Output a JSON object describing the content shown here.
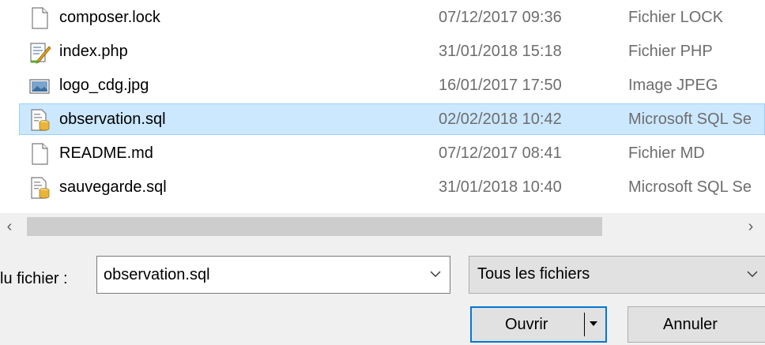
{
  "files": [
    {
      "name": "composer.lock",
      "date": "07/12/2017 09:36",
      "type": "Fichier LOCK",
      "icon": "blank-file-icon",
      "selected": false
    },
    {
      "name": "index.php",
      "date": "31/01/2018 15:18",
      "type": "Fichier PHP",
      "icon": "php-file-icon",
      "selected": false
    },
    {
      "name": "logo_cdg.jpg",
      "date": "16/01/2017 17:50",
      "type": "Image JPEG",
      "icon": "image-file-icon",
      "selected": false
    },
    {
      "name": "observation.sql",
      "date": "02/02/2018 10:42",
      "type": "Microsoft SQL Se",
      "icon": "sql-file-icon",
      "selected": true
    },
    {
      "name": "README.md",
      "date": "07/12/2017 08:41",
      "type": "Fichier MD",
      "icon": "blank-file-icon",
      "selected": false
    },
    {
      "name": "sauvegarde.sql",
      "date": "31/01/2018 10:40",
      "type": "Microsoft SQL Se",
      "icon": "sql-file-icon",
      "selected": false
    }
  ],
  "scrollbar": {
    "left_arrow": "‹",
    "right_arrow": "›"
  },
  "filename": {
    "label": "lu fichier :",
    "value": "observation.sql"
  },
  "filter": {
    "value": "Tous les fichiers"
  },
  "buttons": {
    "open": "Ouvrir",
    "cancel": "Annuler"
  },
  "colors": {
    "selection_bg": "#cce8ff",
    "selection_border": "#99d1ff",
    "focus_border": "#0078d7"
  }
}
